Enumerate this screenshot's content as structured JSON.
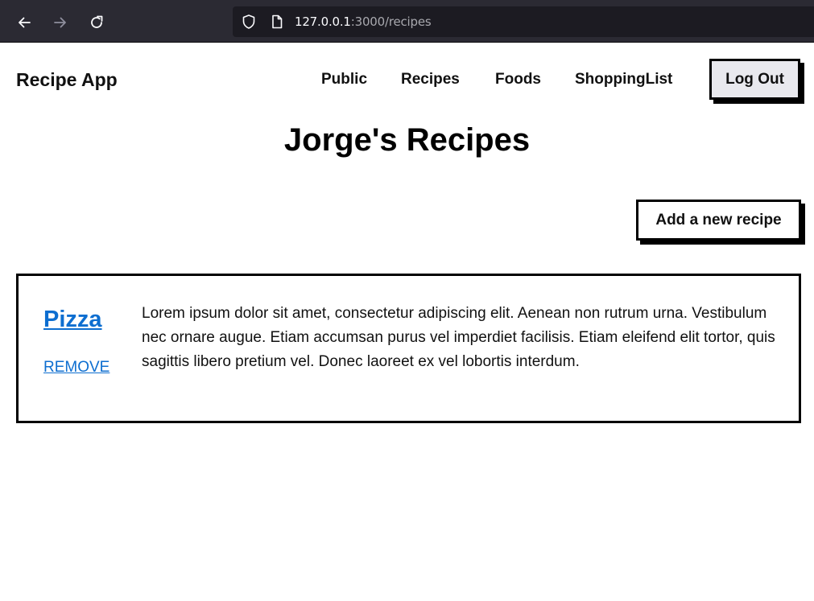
{
  "browser": {
    "url_host": "127.0.0.1",
    "url_rest": ":3000/recipes",
    "icons": {
      "back": "arrow-left-icon",
      "forward": "arrow-right-icon",
      "reload": "reload-icon",
      "tracking": "shield-icon",
      "page": "page-icon"
    }
  },
  "header": {
    "brand": "Recipe App",
    "nav": [
      "Public",
      "Recipes",
      "Foods",
      "ShoppingList"
    ],
    "logout_label": "Log Out"
  },
  "main": {
    "title": "Jorge's Recipes",
    "add_button_label": "Add a new recipe",
    "recipes": [
      {
        "name": "Pizza",
        "remove_label": "REMOVE",
        "description": "Lorem ipsum dolor sit amet, consectetur adipiscing elit. Aenean non rutrum urna. Vestibulum nec ornare augue. Etiam accumsan purus vel imperdiet facilisis. Etiam eleifend elit tortor, quis sagittis libero pretium vel. Donec laoreet ex vel lobortis interdum."
      }
    ]
  },
  "colors": {
    "browser_toolbar": "#2b2a33",
    "urlbar": "#1c1b22",
    "link": "#0d6ed0",
    "logout_bg": "#e9e9ee",
    "border": "#000000"
  }
}
